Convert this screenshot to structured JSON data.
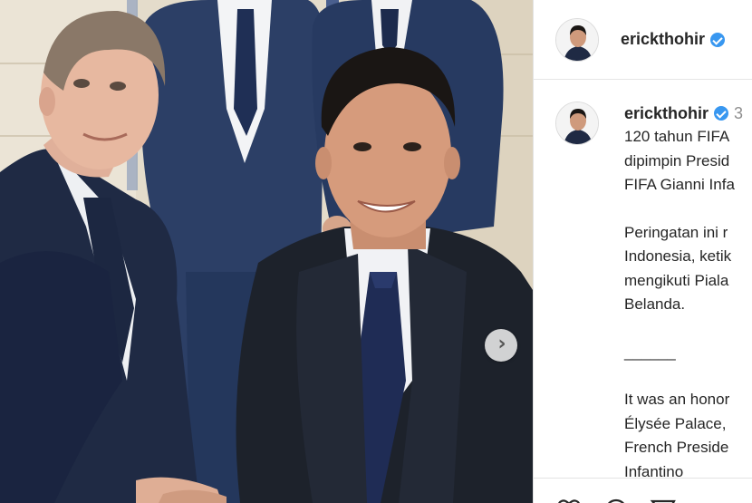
{
  "post": {
    "username": "erickthohir",
    "verified": true,
    "photo_description_icon": "photo",
    "next_icon": "chevron-right-icon"
  },
  "caption": {
    "username": "erickthohir",
    "time_partial": "3",
    "lines_id": [
      "120 tahun FIFA",
      "dipimpin Presid",
      "FIFA Gianni Infa"
    ],
    "lines_id_2": [
      "Peringatan ini r",
      "Indonesia, ketik",
      "mengikuti Piala",
      "Belanda."
    ],
    "separator": "______",
    "lines_en": [
      "It was an honor",
      "Élysée Palace,",
      "French Preside",
      "Infantino"
    ]
  },
  "actions": {
    "icons": [
      "heart-icon",
      "comment-icon",
      "share-icon"
    ]
  },
  "colors": {
    "verified": "#3897f0",
    "text": "#262626",
    "suit_dark": "#1e2430",
    "suit_navy": "#22304f"
  }
}
